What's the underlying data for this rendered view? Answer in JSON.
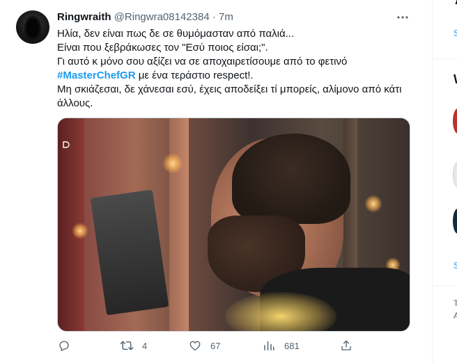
{
  "tweet": {
    "display_name": "Ringwraith",
    "handle": "@Ringwra08142384",
    "separator": "·",
    "time": "7m",
    "more_icon": "more-horizontal-icon",
    "lines": {
      "line1": "Ηλία, δεν είναι πως δε σε θυμόμασταν από παλιά...",
      "line2": "Είναι που ξεβράκωσες τον \"Εσύ ποιος είσαι;\".",
      "line3": "Γι αυτό κ μόνο σου αξίζει να σε αποχαιρετίσουμε από το φετινό",
      "hashtag": "#MasterChefGR",
      "line4_rest": " με ένα τεράστιο respect!.",
      "line5": "Μη σκιάζεσαι, δε χάνεσαι εσύ, έχεις αποδείξει τί μπορείς, αλίμονο από κάτι άλλους."
    },
    "actions": {
      "reply": {
        "icon": "reply-icon",
        "count": ""
      },
      "retweet": {
        "icon": "retweet-icon",
        "count": "4"
      },
      "like": {
        "icon": "like-heart-icon",
        "count": "67"
      },
      "views": {
        "icon": "views-bar-chart-icon",
        "count": "681"
      },
      "share": {
        "icon": "share-icon",
        "count": ""
      }
    },
    "hashtag_color": "#1d9bf0",
    "secondary_text_color": "#536471"
  },
  "right_column": {
    "item1": "A",
    "item2": "S",
    "item3": "W",
    "item4": "S",
    "item5": "T",
    "item6": "A"
  }
}
